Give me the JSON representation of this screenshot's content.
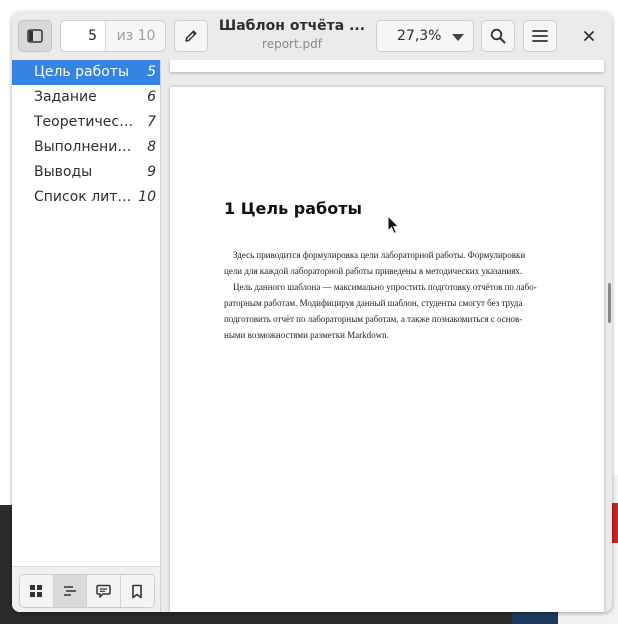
{
  "header": {
    "current_page": "5",
    "page_total": "из 10",
    "title": "Шаблон отчёта ...",
    "subtitle": "report.pdf",
    "zoom": "27,3%"
  },
  "sidebar": {
    "toc": [
      {
        "label": "Цель работы",
        "page": "5",
        "selected": true
      },
      {
        "label": "Задание",
        "page": "6"
      },
      {
        "label": "Теоретичес…",
        "page": "7"
      },
      {
        "label": "Выполнение…",
        "page": "8"
      },
      {
        "label": "Выводы",
        "page": "9"
      },
      {
        "label": "Список лите…",
        "page": "10"
      }
    ]
  },
  "document": {
    "heading": "1  Цель работы",
    "paragraph1": [
      "Здесь приводится формулировка цели лабораторной работы. Формулировки",
      "цели для каждой лабораторной работы приведены в методических указаниях."
    ],
    "paragraph2": [
      "Цель данного шаблона — максимально упростить подготовку отчётов по лабо-",
      "раторным работам. Модифицируя данный шаблон, студенты смогут без труда",
      "подготовить отчёт по лабораторным работам, а также познакомиться с основ-",
      "ными возможностями разметки Markdown."
    ]
  },
  "colors": {
    "accent": "#3584e4",
    "headerbar": "#ebebeb",
    "doc_background": "#ebebeb"
  },
  "icons": [
    "sidebar-toggle-icon",
    "pencil-icon",
    "search-icon",
    "hamburger-icon",
    "close-icon",
    "thumbnails-icon",
    "outline-icon",
    "annotations-icon",
    "bookmarks-icon",
    "mouse-cursor-icon"
  ]
}
